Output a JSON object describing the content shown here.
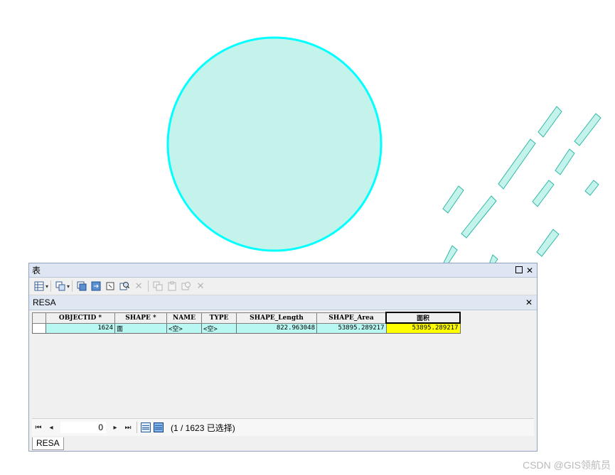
{
  "table_window": {
    "title": "表",
    "tab_name": "RESA",
    "bottom_tab": "RESA"
  },
  "toolbar": {
    "icons": [
      "table-options-icon",
      "related-tables-icon",
      "select-by-attributes-icon",
      "switch-selection-icon",
      "clear-selection-icon",
      "zoom-to-selected-icon",
      "delete-selected-icon",
      "copy-icon",
      "paste-icon",
      "copy-selected-icon",
      "delete-icon"
    ]
  },
  "attribute_table": {
    "columns": [
      "OBJECTID *",
      "SHAPE *",
      "NAME",
      "TYPE",
      "SHAPE_Length",
      "SHAPE_Area",
      "面积"
    ],
    "rows": [
      [
        "1624",
        "面",
        "<空>",
        "<空>",
        "822.963048",
        "53895.289217",
        "53895.289217"
      ]
    ],
    "selected_column": "面积"
  },
  "navigator": {
    "record_value": "0",
    "selection_status": "(1 / 1623 已选择)"
  },
  "watermark": "CSDN @GIS领航员",
  "colors": {
    "feature_fill": "#c4f3ec",
    "selection_outline": "#00ffff",
    "selected_row": "#b9f7f2",
    "highlight_cell": "#ffff00"
  }
}
